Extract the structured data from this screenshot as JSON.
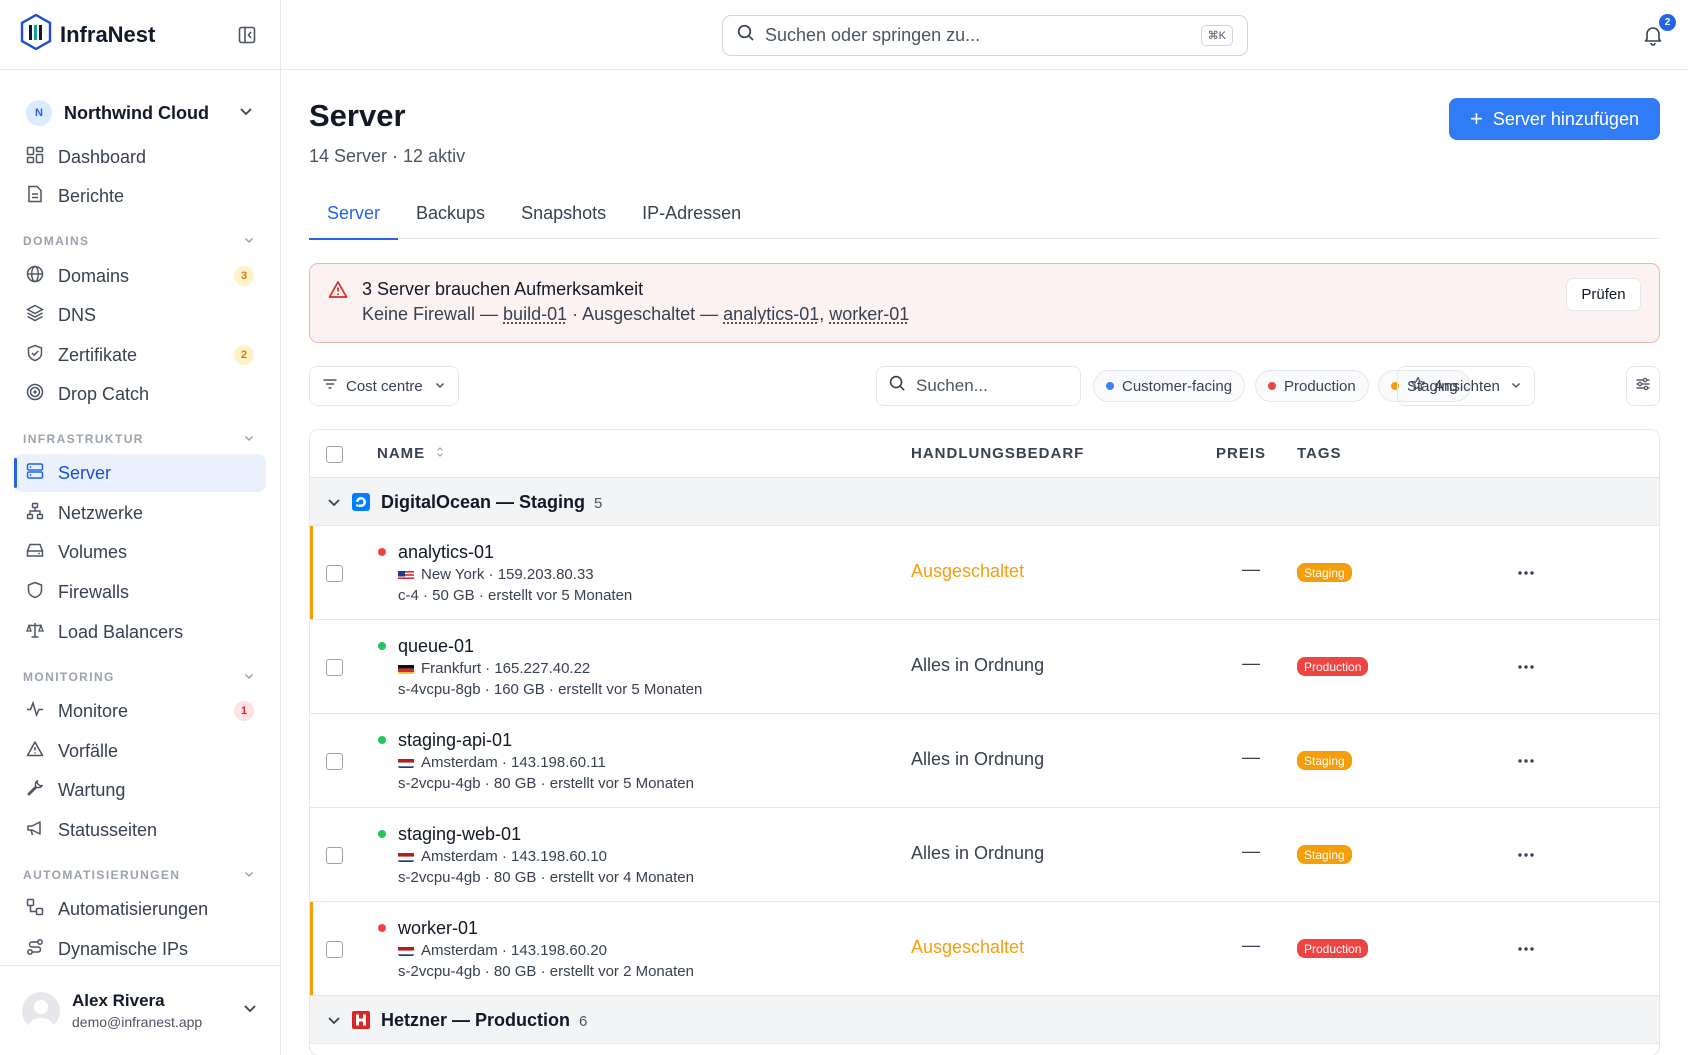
{
  "app": {
    "name": "InfraNest"
  },
  "sidebar": {
    "org": {
      "initial": "N",
      "name": "Northwind Cloud"
    },
    "top_items": [
      {
        "label": "Dashboard"
      },
      {
        "label": "Berichte"
      }
    ],
    "sections": [
      {
        "title": "DOMAINS",
        "items": [
          {
            "label": "Domains",
            "badge": "3"
          },
          {
            "label": "DNS"
          },
          {
            "label": "Zertifikate",
            "badge": "2"
          },
          {
            "label": "Drop Catch"
          }
        ]
      },
      {
        "title": "INFRASTRUKTUR",
        "items": [
          {
            "label": "Server",
            "active": true
          },
          {
            "label": "Netzwerke"
          },
          {
            "label": "Volumes"
          },
          {
            "label": "Firewalls"
          },
          {
            "label": "Load Balancers"
          }
        ]
      },
      {
        "title": "MONITORING",
        "items": [
          {
            "label": "Monitore",
            "badge": "1"
          },
          {
            "label": "Vorfälle"
          },
          {
            "label": "Wartung"
          },
          {
            "label": "Statusseiten"
          }
        ]
      },
      {
        "title": "AUTOMATISIERUNGEN",
        "items": [
          {
            "label": "Automatisierungen"
          },
          {
            "label": "Dynamische IPs"
          }
        ]
      }
    ],
    "user": {
      "name": "Alex Rivera",
      "email": "demo@infranest.app"
    }
  },
  "topbar": {
    "search_placeholder": "Suchen oder springen zu...",
    "shortcut": "⌘K",
    "notification_count": "2"
  },
  "page": {
    "title": "Server",
    "subtitle": "14 Server · 12 aktiv",
    "add_button": "Server hinzufügen",
    "tabs": [
      "Server",
      "Backups",
      "Snapshots",
      "IP-Adressen"
    ]
  },
  "alert": {
    "title": "3 Server brauchen Aufmerksamkeit",
    "text_prefix": "Keine Firewall — ",
    "link1": "build-01",
    "text_mid": " · Ausgeschaltet — ",
    "link2": "analytics-01",
    "sep": ", ",
    "link3": "worker-01",
    "button": "Prüfen"
  },
  "filters": {
    "cost_centre": "Cost centre",
    "search_placeholder": "Suchen...",
    "chips": [
      {
        "label": "Customer-facing",
        "color": "#3b82f6"
      },
      {
        "label": "Production",
        "color": "#ef4444"
      },
      {
        "label": "Staging",
        "color": "#f59e0b"
      }
    ],
    "views": "Ansichten"
  },
  "table": {
    "headers": {
      "name": "NAME",
      "need": "HANDLUNGSBEDARF",
      "price": "PREIS",
      "tags": "TAGS"
    },
    "groups": [
      {
        "name": "DigitalOcean — Staging",
        "count": "5"
      },
      {
        "name": "Hetzner — Production",
        "count": "6"
      }
    ],
    "rows": [
      {
        "name": "analytics-01",
        "status": "off",
        "flag": "us",
        "location": "New York · 159.203.80.33",
        "spec": "c-4 · 50 GB · erstellt vor 5 Monaten",
        "need": "Ausgeschaltet",
        "price": "—",
        "tag": "Staging"
      },
      {
        "name": "queue-01",
        "status": "on",
        "flag": "de",
        "location": "Frankfurt · 165.227.40.22",
        "spec": "s-4vcpu-8gb · 160 GB · erstellt vor 5 Monaten",
        "need": "Alles in Ordnung",
        "price": "—",
        "tag": "Production"
      },
      {
        "name": "staging-api-01",
        "status": "on",
        "flag": "nl",
        "location": "Amsterdam · 143.198.60.11",
        "spec": "s-2vcpu-4gb · 80 GB · erstellt vor 5 Monaten",
        "need": "Alles in Ordnung",
        "price": "—",
        "tag": "Staging"
      },
      {
        "name": "staging-web-01",
        "status": "on",
        "flag": "nl",
        "location": "Amsterdam · 143.198.60.10",
        "spec": "s-2vcpu-4gb · 80 GB · erstellt vor 4 Monaten",
        "need": "Alles in Ordnung",
        "price": "—",
        "tag": "Staging"
      },
      {
        "name": "worker-01",
        "status": "off",
        "flag": "nl",
        "location": "Amsterdam · 143.198.60.20",
        "spec": "s-2vcpu-4gb · 80 GB · erstellt vor 2 Monaten",
        "need": "Ausgeschaltet",
        "price": "—",
        "tag": "Production"
      }
    ]
  },
  "colors": {
    "accent": "#2f7cf6",
    "online": "#22c55e",
    "offline": "#ef4444",
    "warning": "#f59e0b"
  }
}
